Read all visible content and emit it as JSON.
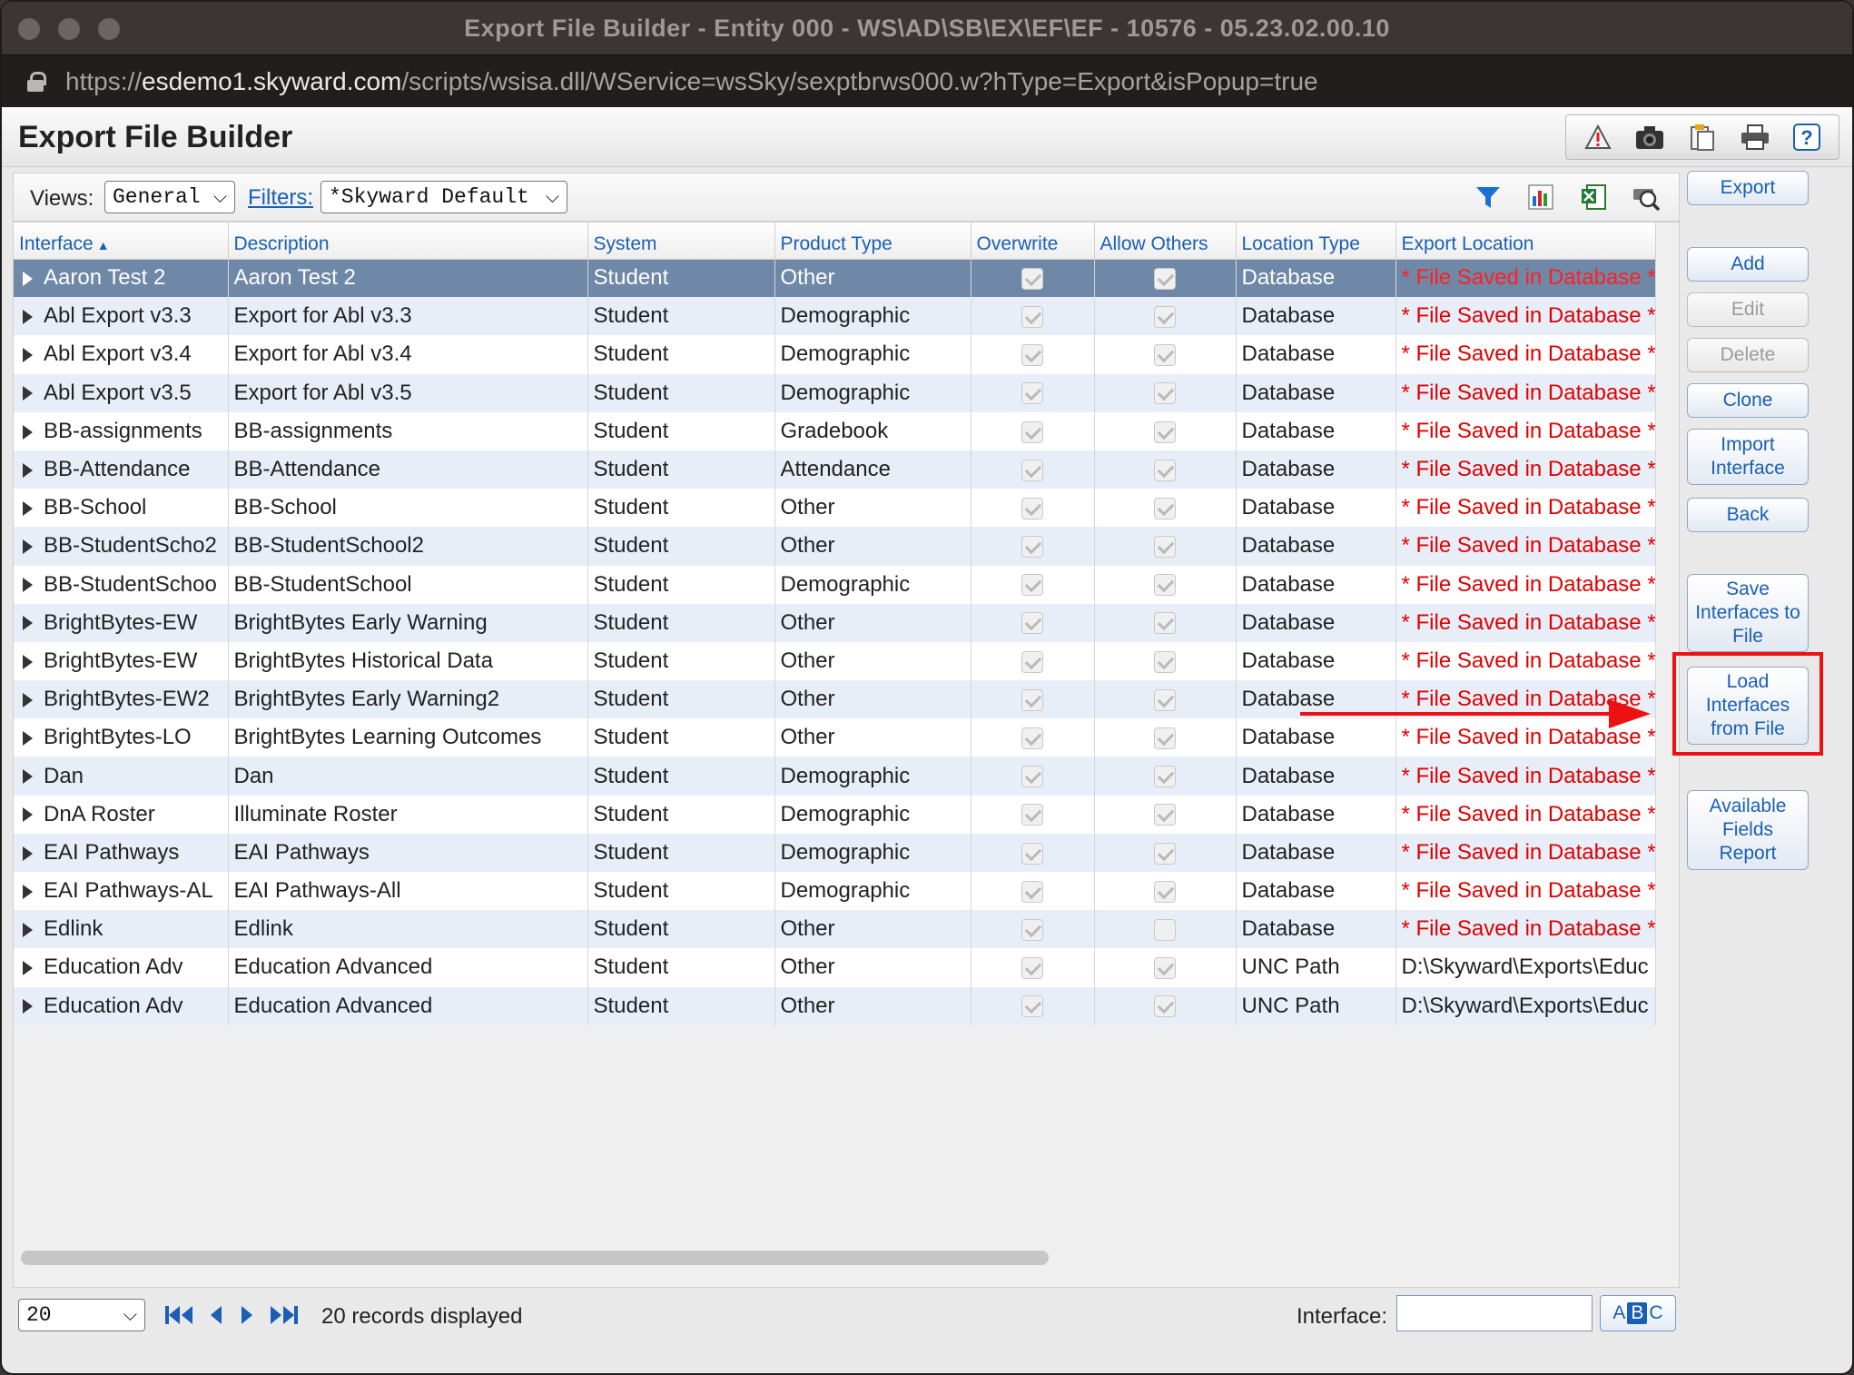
{
  "window": {
    "title": "Export File Builder - Entity 000 - WS\\AD\\SB\\EX\\EF\\EF - 10576 - 05.23.02.00.10"
  },
  "url": {
    "scheme": "https://",
    "host": "esdemo1.skyward.com",
    "path": "/scripts/wsisa.dll/WService=wsSky/sexptbrws000.w?hType=Export&isPopup=true"
  },
  "page": {
    "title": "Export File Builder"
  },
  "toolbar": {
    "icons": [
      "alert-icon",
      "camera-icon",
      "clipboard-icon",
      "print-icon",
      "help-icon"
    ],
    "help_label": "?"
  },
  "filterbar": {
    "views_label": "Views:",
    "views_value": "General",
    "filters_label": "Filters:",
    "filters_value": "*Skyward Default"
  },
  "columns": [
    "Interface",
    "Description",
    "System",
    "Product Type",
    "Overwrite",
    "Allow Others",
    "Location Type",
    "Export Location"
  ],
  "rows": [
    {
      "interface": "Aaron Test 2",
      "description": "Aaron Test 2",
      "system": "Student",
      "product_type": "Other",
      "overwrite": true,
      "allow_others": true,
      "location_type": "Database",
      "export_location": "* File Saved in Database *"
    },
    {
      "interface": "Abl Export v3.3",
      "description": "Export for Abl v3.3",
      "system": "Student",
      "product_type": "Demographic",
      "overwrite": true,
      "allow_others": true,
      "location_type": "Database",
      "export_location": "* File Saved in Database *"
    },
    {
      "interface": "Abl Export v3.4",
      "description": "Export for Abl v3.4",
      "system": "Student",
      "product_type": "Demographic",
      "overwrite": true,
      "allow_others": true,
      "location_type": "Database",
      "export_location": "* File Saved in Database *"
    },
    {
      "interface": "Abl Export v3.5",
      "description": "Export for Abl v3.5",
      "system": "Student",
      "product_type": "Demographic",
      "overwrite": true,
      "allow_others": true,
      "location_type": "Database",
      "export_location": "* File Saved in Database *"
    },
    {
      "interface": "BB-assignments",
      "description": "BB-assignments",
      "system": "Student",
      "product_type": "Gradebook",
      "overwrite": true,
      "allow_others": true,
      "location_type": "Database",
      "export_location": "* File Saved in Database *"
    },
    {
      "interface": "BB-Attendance",
      "description": "BB-Attendance",
      "system": "Student",
      "product_type": "Attendance",
      "overwrite": true,
      "allow_others": true,
      "location_type": "Database",
      "export_location": "* File Saved in Database *"
    },
    {
      "interface": "BB-School",
      "description": "BB-School",
      "system": "Student",
      "product_type": "Other",
      "overwrite": true,
      "allow_others": true,
      "location_type": "Database",
      "export_location": "* File Saved in Database *"
    },
    {
      "interface": "BB-StudentScho2",
      "description": "BB-StudentSchool2",
      "system": "Student",
      "product_type": "Other",
      "overwrite": true,
      "allow_others": true,
      "location_type": "Database",
      "export_location": "* File Saved in Database *"
    },
    {
      "interface": "BB-StudentSchoo",
      "description": "BB-StudentSchool",
      "system": "Student",
      "product_type": "Demographic",
      "overwrite": true,
      "allow_others": true,
      "location_type": "Database",
      "export_location": "* File Saved in Database *"
    },
    {
      "interface": "BrightBytes-EW",
      "description": "BrightBytes Early Warning",
      "system": "Student",
      "product_type": "Other",
      "overwrite": true,
      "allow_others": true,
      "location_type": "Database",
      "export_location": "* File Saved in Database *"
    },
    {
      "interface": "BrightBytes-EW",
      "description": "BrightBytes Historical Data",
      "system": "Student",
      "product_type": "Other",
      "overwrite": true,
      "allow_others": true,
      "location_type": "Database",
      "export_location": "* File Saved in Database *"
    },
    {
      "interface": "BrightBytes-EW2",
      "description": "BrightBytes Early Warning2",
      "system": "Student",
      "product_type": "Other",
      "overwrite": true,
      "allow_others": true,
      "location_type": "Database",
      "export_location": "* File Saved in Database *"
    },
    {
      "interface": "BrightBytes-LO",
      "description": "BrightBytes Learning Outcomes",
      "system": "Student",
      "product_type": "Other",
      "overwrite": true,
      "allow_others": true,
      "location_type": "Database",
      "export_location": "* File Saved in Database *"
    },
    {
      "interface": "Dan",
      "description": "Dan",
      "system": "Student",
      "product_type": "Demographic",
      "overwrite": true,
      "allow_others": true,
      "location_type": "Database",
      "export_location": "* File Saved in Database *"
    },
    {
      "interface": "DnA Roster",
      "description": "Illuminate Roster",
      "system": "Student",
      "product_type": "Demographic",
      "overwrite": true,
      "allow_others": true,
      "location_type": "Database",
      "export_location": "* File Saved in Database *"
    },
    {
      "interface": "EAI Pathways",
      "description": "EAI Pathways",
      "system": "Student",
      "product_type": "Demographic",
      "overwrite": true,
      "allow_others": true,
      "location_type": "Database",
      "export_location": "* File Saved in Database *"
    },
    {
      "interface": "EAI Pathways-AL",
      "description": "EAI Pathways-All",
      "system": "Student",
      "product_type": "Demographic",
      "overwrite": true,
      "allow_others": true,
      "location_type": "Database",
      "export_location": "* File Saved in Database *"
    },
    {
      "interface": "Edlink",
      "description": "Edlink",
      "system": "Student",
      "product_type": "Other",
      "overwrite": true,
      "allow_others": false,
      "location_type": "Database",
      "export_location": "* File Saved in Database *"
    },
    {
      "interface": "Education Adv",
      "description": "Education Advanced",
      "system": "Student",
      "product_type": "Other",
      "overwrite": true,
      "allow_others": true,
      "location_type": "UNC Path",
      "export_location": "D:\\Skyward\\Exports\\Educ"
    },
    {
      "interface": "Education Adv",
      "description": "Education Advanced",
      "system": "Student",
      "product_type": "Other",
      "overwrite": true,
      "allow_others": true,
      "location_type": "UNC Path",
      "export_location": "D:\\Skyward\\Exports\\Educ"
    }
  ],
  "footer": {
    "page_size": "20",
    "records_text": "20 records displayed",
    "search_label": "Interface:",
    "search_value": "",
    "abc_a": "A",
    "abc_b": "B",
    "abc_c": "C"
  },
  "side_buttons": {
    "export": "Export",
    "add": "Add",
    "edit": "Edit",
    "delete": "Delete",
    "clone": "Clone",
    "import": "Import Interface",
    "back": "Back",
    "save_to_file": "Save Interfaces to File",
    "load_from_file": "Load Interfaces from File",
    "available_fields": "Available Fields Report"
  },
  "colors": {
    "accent": "#1a5fb4",
    "selected_row": "#6f88a8",
    "alt_row": "#e8eef8",
    "location_text": "#e00000",
    "highlight": "#ee1111"
  }
}
